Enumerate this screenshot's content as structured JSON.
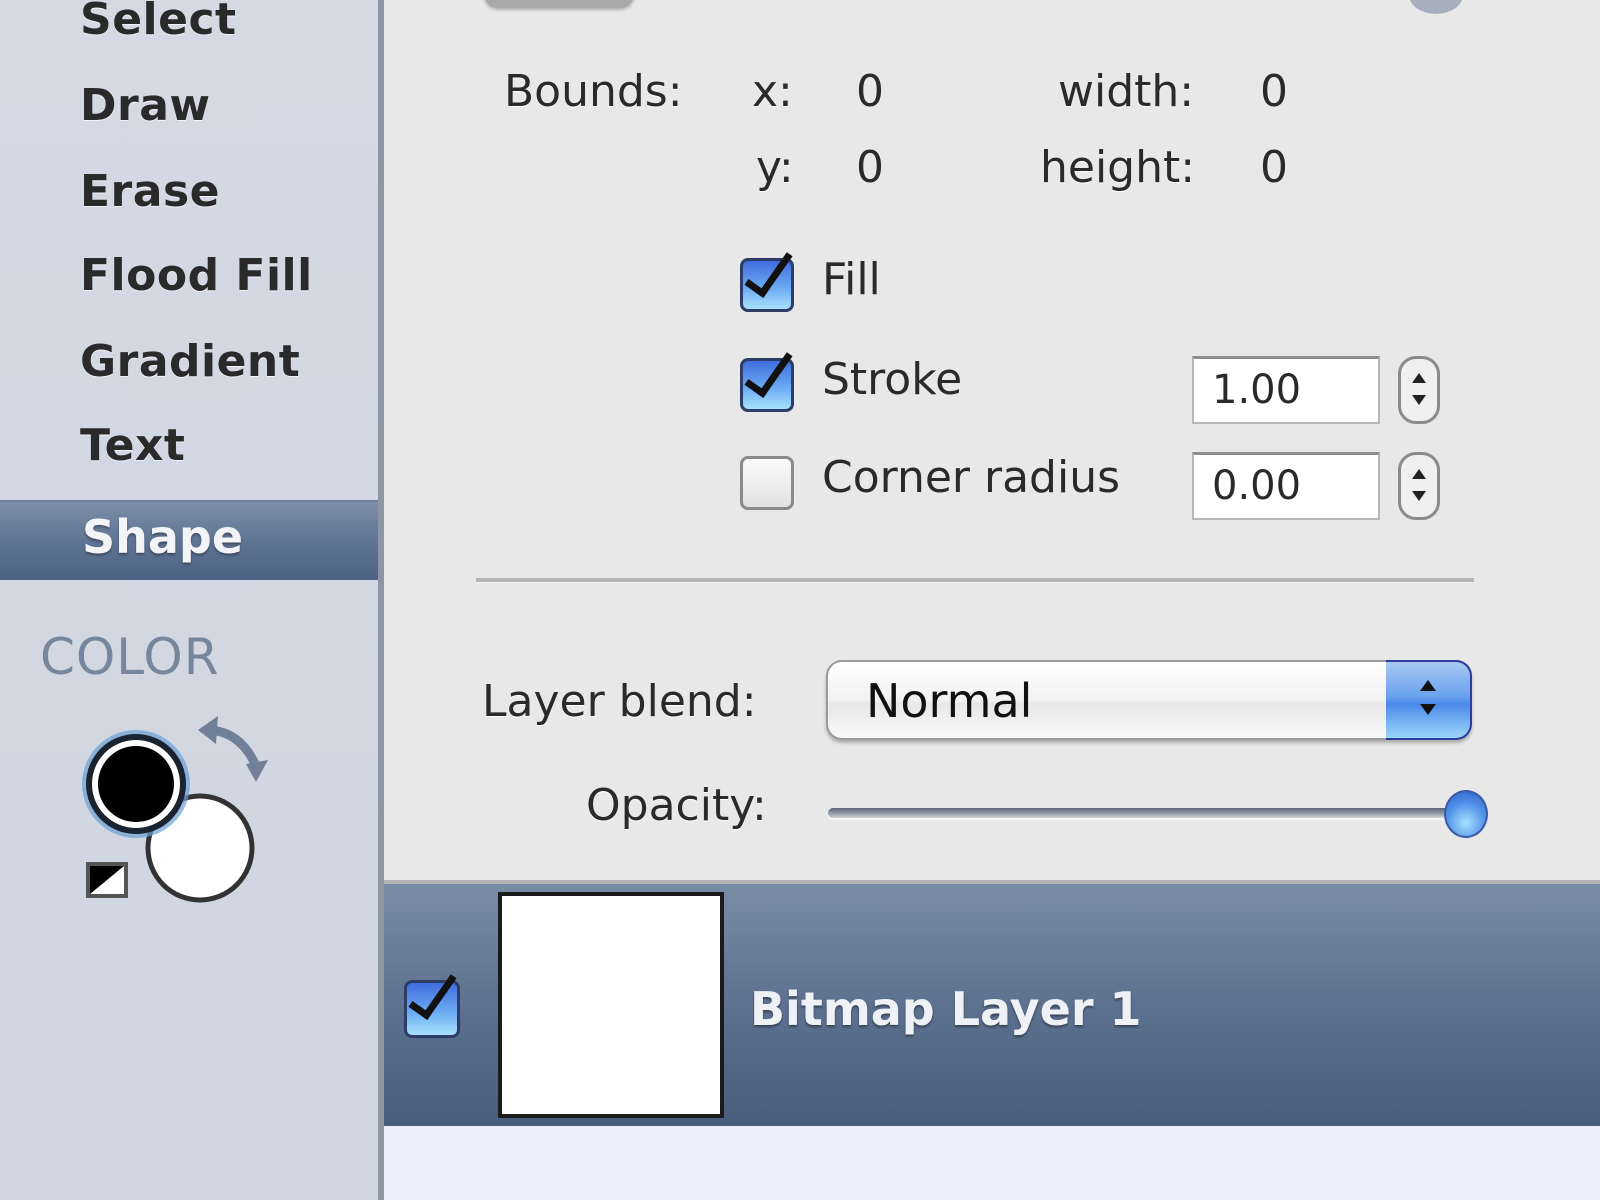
{
  "sidebar": {
    "tools": [
      {
        "label": "Select",
        "selected": false
      },
      {
        "label": "Draw",
        "selected": false
      },
      {
        "label": "Erase",
        "selected": false
      },
      {
        "label": "Flood Fill",
        "selected": false
      },
      {
        "label": "Gradient",
        "selected": false
      },
      {
        "label": "Text",
        "selected": false
      },
      {
        "label": "Shape",
        "selected": true
      }
    ],
    "color": {
      "heading": "COLOR",
      "foreground": "#000000",
      "background": "#ffffff",
      "swap_icon": "swap-arrows-icon",
      "reset_icon": "default-colors-icon"
    }
  },
  "shape_options": {
    "bounds": {
      "label": "Bounds:",
      "x_label": "x:",
      "x": "0",
      "y_label": "y:",
      "y": "0",
      "width_label": "width:",
      "width": "0",
      "height_label": "height:",
      "height": "0"
    },
    "fill": {
      "label": "Fill",
      "checked": true
    },
    "stroke": {
      "label": "Stroke",
      "checked": true,
      "value": "1.00"
    },
    "corner_radius": {
      "label": "Corner radius",
      "checked": false,
      "value": "0.00"
    }
  },
  "layer_settings": {
    "blend_label": "Layer blend:",
    "blend_value": "Normal",
    "opacity_label": "Opacity:",
    "opacity_percent": 100
  },
  "layers": [
    {
      "name": "Bitmap Layer 1",
      "visible": true,
      "selected": true
    }
  ],
  "colors": {
    "accent": "#4a8ae8",
    "selection": "#5d7190",
    "sidebar_bg": "#d2d8e3",
    "panel_bg": "#e8e8e8"
  }
}
